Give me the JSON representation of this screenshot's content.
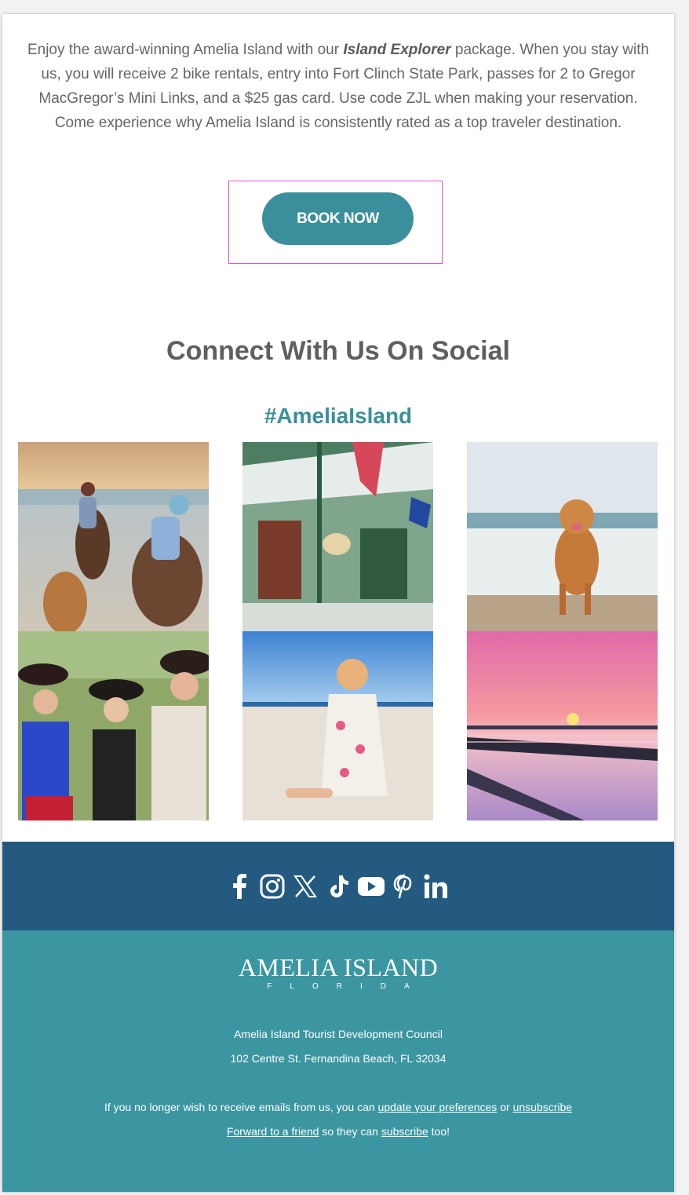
{
  "intro": {
    "before": "Enjoy the award-winning Amelia Island with our ",
    "package": "Island Explorer",
    "after": " package. When you stay with us, you will receive 2 bike rentals, entry into Fort Clinch State Park, passes for 2 to Gregor MacGregor’s Mini Links, and a $25 gas card. Use code ZJL when making your reservation. Come experience why Amelia Island is consistently rated as a top traveler destination."
  },
  "cta": {
    "label": "BOOK NOW"
  },
  "social": {
    "heading": "Connect With Us On Social",
    "hashtag": "#AmeliaIsland",
    "icons": [
      "facebook-icon",
      "instagram-icon",
      "x-icon",
      "tiktok-icon",
      "youtube-icon",
      "pinterest-icon",
      "linkedin-icon"
    ]
  },
  "footer": {
    "logo_word": "AMELIA ISLAND",
    "logo_sub": "FLORIDA",
    "org": "Amelia Island Tourist Development Council",
    "address": "102 Centre St. Fernandina Beach, FL 32034",
    "unsub_prefix": "If you no longer wish to receive emails from us, you can ",
    "update_link": "update your preferences",
    "or": " or ",
    "unsub_link": "unsubscribe",
    "forward_link": "Forward to a friend",
    "so_they": " so they can ",
    "subscribe_link": "subscribe",
    "too": " too!"
  },
  "colors": {
    "accent": "#3b8f9c",
    "social_bar": "#245a80",
    "footer": "#3b96a2",
    "highlight": "#e34ce3"
  }
}
